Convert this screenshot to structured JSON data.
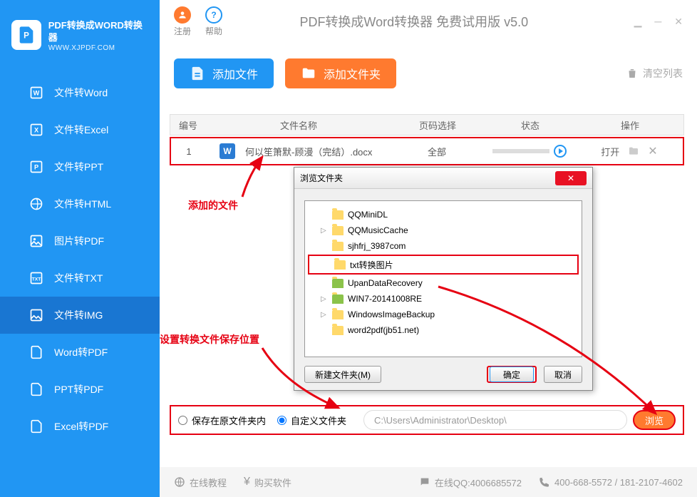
{
  "logo": {
    "title": "PDF转换成WORD转换器",
    "sub": "WWW.XJPDF.COM"
  },
  "topbar": {
    "register": "注册",
    "help": "帮助",
    "title": "PDF转换成Word转换器 免费试用版 v5.0"
  },
  "nav": [
    {
      "label": "文件转Word",
      "icon": "W"
    },
    {
      "label": "文件转Excel",
      "icon": "X"
    },
    {
      "label": "文件转PPT",
      "icon": "P"
    },
    {
      "label": "文件转HTML",
      "icon": "H"
    },
    {
      "label": "图片转PDF",
      "icon": "I"
    },
    {
      "label": "文件转TXT",
      "icon": "T"
    },
    {
      "label": "文件转IMG",
      "icon": "G"
    },
    {
      "label": "Word转PDF",
      "icon": "D"
    },
    {
      "label": "PPT转PDF",
      "icon": "D"
    },
    {
      "label": "Excel转PDF",
      "icon": "D"
    }
  ],
  "toolbar": {
    "add_file": "添加文件",
    "add_folder": "添加文件夹",
    "clear": "清空列表"
  },
  "table": {
    "headers": {
      "num": "编号",
      "name": "文件名称",
      "page": "页码选择",
      "status": "状态",
      "op": "操作"
    },
    "rows": [
      {
        "num": "1",
        "filename": "何以笙箫默-顾漫（完结）.docx",
        "page": "全部",
        "open": "打开"
      }
    ]
  },
  "annotations": {
    "added_file": "添加的文件",
    "save_location": "设置转换文件保存位置"
  },
  "dialog": {
    "title": "浏览文件夹",
    "items": [
      "QQMiniDL",
      "QQMusicCache",
      "sjhfrj_3987com",
      "txt转换图片",
      "UpanDataRecovery",
      "WIN7-20141008RE",
      "WindowsImageBackup",
      "word2pdf(jb51.net)"
    ],
    "new_folder": "新建文件夹(M)",
    "ok": "确定",
    "cancel": "取消"
  },
  "save": {
    "opt1": "保存在原文件夹内",
    "opt2": "自定义文件夹",
    "path": "C:\\Users\\Administrator\\Desktop\\",
    "browse": "浏览"
  },
  "footer": {
    "tutorial": "在线教程",
    "buy": "购买软件",
    "qq": "在线QQ:4006685572",
    "phone": "400-668-5572 / 181-2107-4602"
  }
}
